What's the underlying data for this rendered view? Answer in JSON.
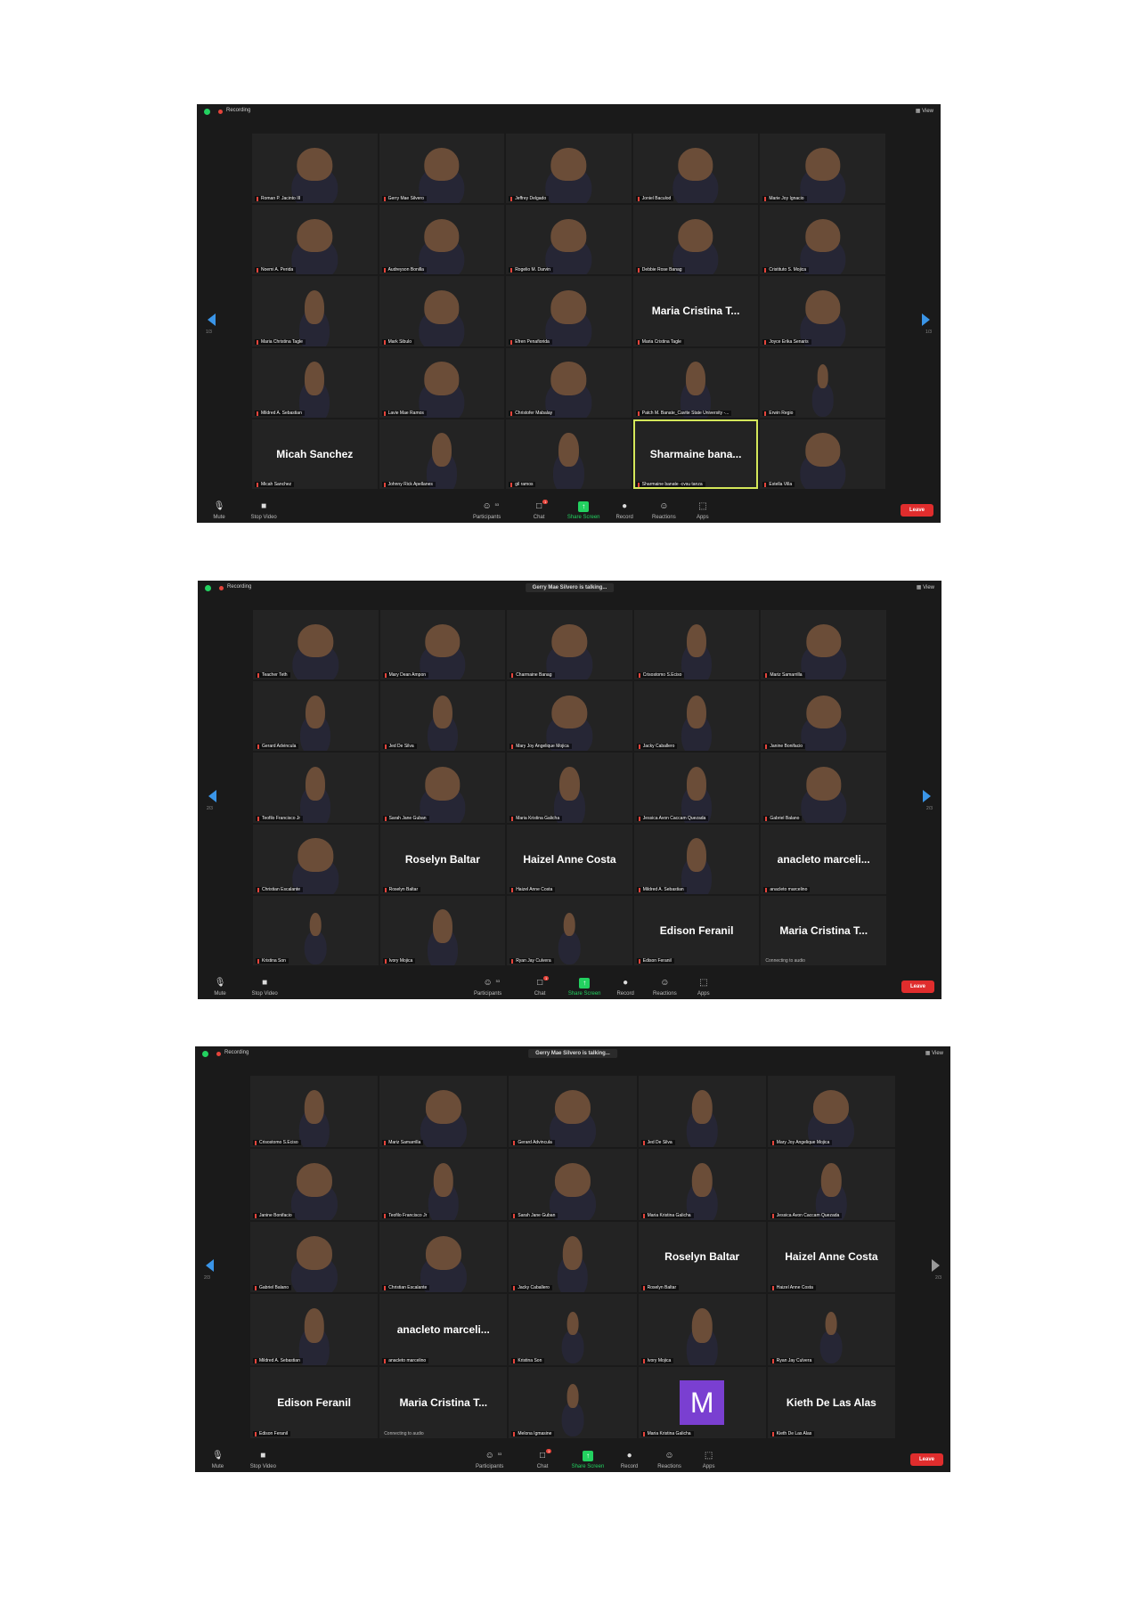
{
  "meetings": [
    {
      "recording_label": "Recording",
      "view_label": "View",
      "talking": "",
      "page_left": "1/3",
      "page_right": "1/3",
      "tiles": [
        {
          "name": "Roman P. Jacinto III",
          "video": true,
          "layout": "full"
        },
        {
          "name": "Gerry Mae Silvero",
          "video": true,
          "layout": "full"
        },
        {
          "name": "Jeffrey Delgado",
          "video": true,
          "layout": "full"
        },
        {
          "name": "Joniel Baculod",
          "video": true,
          "layout": "full"
        },
        {
          "name": "Marie Joy Ignacio",
          "video": true,
          "layout": "full"
        },
        {
          "name": "Noemi A. Perida",
          "video": true,
          "layout": "full"
        },
        {
          "name": "Audreyson Bonilla",
          "video": true,
          "layout": "full"
        },
        {
          "name": "Rogelio M. Darvin",
          "video": true,
          "layout": "full"
        },
        {
          "name": "Debbie Rose Banag",
          "video": true,
          "layout": "full"
        },
        {
          "name": "Cristituto S. Mojica",
          "video": true,
          "layout": "full"
        },
        {
          "name": "Maria Christina Tagle",
          "video": true,
          "layout": "narrow"
        },
        {
          "name": "Mark Sibulo",
          "video": true,
          "layout": "full"
        },
        {
          "name": "Efren Penafiorida",
          "video": true,
          "layout": "full"
        },
        {
          "name": "Maria Cristina Tagle",
          "big": "Maria Cristina T..."
        },
        {
          "name": "Joyce Erika Senaris",
          "video": true,
          "layout": "full"
        },
        {
          "name": "Mildred A. Sebastian",
          "video": true,
          "layout": "narrow"
        },
        {
          "name": "Lavie Mae Ramos",
          "video": true,
          "layout": "full"
        },
        {
          "name": "Christofer Mabalay",
          "video": true,
          "layout": "full"
        },
        {
          "name": "Patch M. Banate_Cavite State University -...",
          "video": true,
          "layout": "narrow"
        },
        {
          "name": "Erwin Regio",
          "video": true,
          "layout": "tiny"
        },
        {
          "name": "Micah Sanchez",
          "big": "Micah Sanchez"
        },
        {
          "name": "Johnny Rick Apellanes",
          "video": true,
          "layout": "narrow"
        },
        {
          "name": "gil ramos",
          "video": true,
          "layout": "narrow"
        },
        {
          "name": "Sharmaine banate -cvsu tanza",
          "big": "Sharmaine bana...",
          "active": true
        },
        {
          "name": "Estella Villa",
          "video": true,
          "layout": "full"
        }
      ],
      "toolbar": {
        "mute": "Mute",
        "stop_video": "Stop Video",
        "participants": "Participants",
        "participant_count": "53",
        "chat": "Chat",
        "chat_badge": "1",
        "share": "Share Screen",
        "record": "Record",
        "reactions": "Reactions",
        "apps": "Apps",
        "leave": "Leave"
      }
    },
    {
      "recording_label": "Recording",
      "view_label": "View",
      "talking": "Gerry Mae Silvero is talking...",
      "page_left": "2/3",
      "page_right": "2/3",
      "tiles": [
        {
          "name": "Teacher Teth",
          "video": true,
          "layout": "full"
        },
        {
          "name": "Mary Dean Ampon",
          "video": true,
          "layout": "full"
        },
        {
          "name": "Charmaine Banag",
          "video": true,
          "layout": "full"
        },
        {
          "name": "Crisostomo S.Eciso",
          "video": true,
          "layout": "narrow"
        },
        {
          "name": "Mariz Samarrilla",
          "video": true,
          "layout": "full"
        },
        {
          "name": "Gerard Advincula",
          "video": true,
          "layout": "narrow"
        },
        {
          "name": "Jed De Silva",
          "video": true,
          "layout": "narrow"
        },
        {
          "name": "Mary Joy Angelique Mojica",
          "video": true,
          "layout": "full"
        },
        {
          "name": "Jacky Caballero",
          "video": true,
          "layout": "narrow"
        },
        {
          "name": "Janine Bonifacio",
          "video": true,
          "layout": "full"
        },
        {
          "name": "Teofilo Francisco Jr",
          "video": true,
          "layout": "narrow"
        },
        {
          "name": "Sarah Jane Guban",
          "video": true,
          "layout": "full"
        },
        {
          "name": "Maria Kristina Galicha",
          "video": true,
          "layout": "narrow"
        },
        {
          "name": "Jessica Avon Caccam Quezada",
          "video": true,
          "layout": "narrow"
        },
        {
          "name": "Gabriel Balano",
          "video": true,
          "layout": "full"
        },
        {
          "name": "Christian Escalante",
          "video": true,
          "layout": "full"
        },
        {
          "name": "Roselyn Baltar",
          "big": "Roselyn Baltar"
        },
        {
          "name": "Haizel Anne Costa",
          "big": "Haizel Anne Costa"
        },
        {
          "name": "Mildred A. Sebastian",
          "video": true,
          "layout": "narrow"
        },
        {
          "name": "anacleto marcelino",
          "big": "anacleto marceli..."
        },
        {
          "name": "Kristina Son",
          "video": true,
          "layout": "tiny"
        },
        {
          "name": "Ivory Mojica",
          "video": true,
          "layout": "narrow"
        },
        {
          "name": "Ryan Jay Culvera",
          "video": true,
          "layout": "tiny"
        },
        {
          "name": "Edison Feranil",
          "big": "Edison Feranil"
        },
        {
          "name": "Connecting to audio",
          "big": "Maria Cristina T...",
          "nomark": true
        }
      ],
      "toolbar": {
        "mute": "Mute",
        "stop_video": "Stop Video",
        "participants": "Participants",
        "participant_count": "53",
        "chat": "Chat",
        "chat_badge": "1",
        "share": "Share Screen",
        "record": "Record",
        "reactions": "Reactions",
        "apps": "Apps",
        "leave": "Leave"
      }
    },
    {
      "recording_label": "Recording",
      "view_label": "View",
      "talking": "Gerry Mae Silvero is talking...",
      "page_left": "2/3",
      "page_right": "2/3",
      "tiles": [
        {
          "name": "Crisostomo S.Eciso",
          "video": true,
          "layout": "narrow"
        },
        {
          "name": "Mariz Samarrilla",
          "video": true,
          "layout": "full"
        },
        {
          "name": "Gerard Advincula",
          "video": true,
          "layout": "full"
        },
        {
          "name": "Jed De Silva",
          "video": true,
          "layout": "narrow"
        },
        {
          "name": "Mary Joy Angelique Mojica",
          "video": true,
          "layout": "full"
        },
        {
          "name": "Janine Bonifacio",
          "video": true,
          "layout": "full"
        },
        {
          "name": "Teofilo Francisco Jr",
          "video": true,
          "layout": "narrow"
        },
        {
          "name": "Sarah Jane Guban",
          "video": true,
          "layout": "full"
        },
        {
          "name": "Maria Kristina Galicha",
          "video": true,
          "layout": "narrow"
        },
        {
          "name": "Jessica Avon Caccam Quezada",
          "video": true,
          "layout": "narrow"
        },
        {
          "name": "Gabriel Balano",
          "video": true,
          "layout": "full"
        },
        {
          "name": "Christian Escalante",
          "video": true,
          "layout": "full"
        },
        {
          "name": "Jacky Caballero",
          "video": true,
          "layout": "narrow"
        },
        {
          "name": "Roselyn Baltar",
          "big": "Roselyn Baltar"
        },
        {
          "name": "Haizel Anne Costa",
          "big": "Haizel Anne Costa"
        },
        {
          "name": "Mildred A. Sebastian",
          "video": true,
          "layout": "narrow"
        },
        {
          "name": "anacleto marcelino",
          "big": "anacleto marceli..."
        },
        {
          "name": "Kristina Son",
          "video": true,
          "layout": "tiny"
        },
        {
          "name": "Ivory Mojica",
          "video": true,
          "layout": "narrow"
        },
        {
          "name": "Ryan Jay Culvera",
          "video": true,
          "layout": "tiny"
        },
        {
          "name": "Edison Feranil",
          "big": "Edison Feranil"
        },
        {
          "name": "Connecting to audio",
          "big": "Maria Cristina T...",
          "nomark": true
        },
        {
          "name": "Melona Igmasine",
          "video": true,
          "layout": "tiny"
        },
        {
          "name": "Maria Kristina Galicha",
          "avatar": "M"
        },
        {
          "name": "Kieth De Las Alas",
          "big": "Kieth De Las Alas"
        }
      ],
      "toolbar": {
        "mute": "Mute",
        "stop_video": "Stop Video",
        "participants": "Participants",
        "participant_count": "53",
        "chat": "Chat",
        "chat_badge": "1",
        "share": "Share Screen",
        "record": "Record",
        "reactions": "Reactions",
        "apps": "Apps",
        "leave": "Leave"
      }
    }
  ]
}
